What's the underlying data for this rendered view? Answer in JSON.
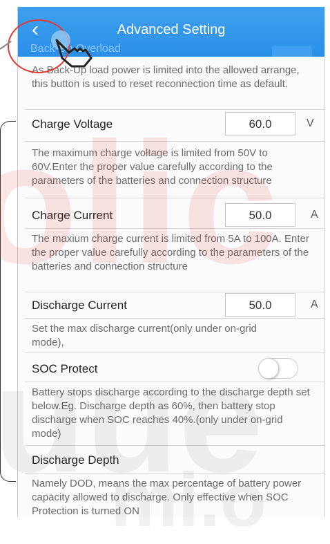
{
  "header": {
    "title": "Advanced Setting",
    "back_icon": "‹",
    "hidden_label": "Back-Up Overload",
    "accent_color": "#2a8fe8"
  },
  "watermark": {
    "line1": "olic",
    "line2": "uue",
    "line3": "mi.o"
  },
  "sections": {
    "backup": {
      "description": "As Back-Up load power is limited into the allowed arrange, this button is used to reset reconnection time as default."
    },
    "charge_voltage": {
      "label": "Charge Voltage",
      "value": "60.0",
      "unit": "V",
      "description": "The maximum charge voltage is limited from 50V to 60V.Enter the proper value carefully according to the parameters of the batteries and connection structure"
    },
    "charge_current": {
      "label": "Charge Current",
      "value": "50.0",
      "unit": "A",
      "description": "The maxium charge current is limited from 5A to 100A. Enter the proper value carefully according to the parameters of the batteries and connection structure"
    },
    "discharge_current": {
      "label": "Discharge Current",
      "value": "50.0",
      "unit": "A",
      "description": "Set the max discharge current(only under on-grid mode),"
    },
    "soc_protect": {
      "label": "SOC Protect",
      "enabled": false,
      "description": "Battery stops discharge according to the discharge depth set below.Eg. Discharge depth as 60%, then battery stop discharge when SOC reaches 40%.(only under on-grid mode)"
    },
    "discharge_depth": {
      "label": "Discharge Depth",
      "description": "Namely DOD, means the max percentage of battery power capacity allowed to discharge. Only effective when SOC Protection is turned ON"
    }
  }
}
